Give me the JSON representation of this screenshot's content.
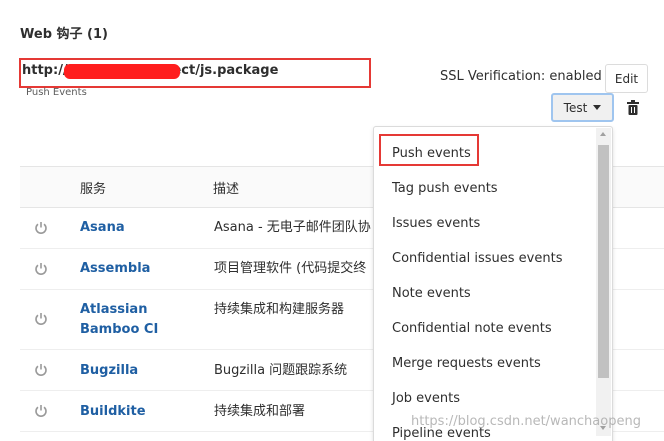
{
  "webhooks": {
    "title": "Web 钩子 (1)",
    "hook": {
      "url": "http://3                              /jenkins/project/js.package",
      "events_label": "Push Events",
      "ssl_text": "SSL Verification: enabled",
      "edit_label": "Edit",
      "test_label": "Test"
    }
  },
  "table": {
    "headers": {
      "service": "服务",
      "description": "描述"
    },
    "rows": [
      {
        "service": "Asana",
        "description": "Asana - 无电子邮件团队协"
      },
      {
        "service": "Assembla",
        "description": "项目管理软件 (代码提交终"
      },
      {
        "service": "Atlassian Bamboo CI",
        "description": "持续集成和构建服务器"
      },
      {
        "service": "Bugzilla",
        "description": "Bugzilla 问题跟踪系统"
      },
      {
        "service": "Buildkite",
        "description": "持续集成和部署"
      }
    ]
  },
  "test_menu": {
    "items": [
      "Push events",
      "Tag push events",
      "Issues events",
      "Confidential issues events",
      "Note events",
      "Confidential note events",
      "Merge requests events",
      "Job events",
      "Pipeline events"
    ],
    "highlighted": "Push events"
  },
  "watermark": "https://blog.csdn.net/wanchaopeng",
  "colors": {
    "link": "#1f5fa3",
    "highlight_border": "#e53935",
    "test_button_border": "#9fc5ef"
  },
  "icons": [
    "power-icon",
    "trash-icon",
    "caret-down-icon"
  ]
}
